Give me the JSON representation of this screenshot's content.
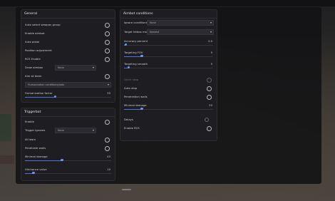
{
  "general": {
    "title": "General",
    "rows": [
      {
        "label": "Auto select weapon group",
        "type": "toggle"
      },
      {
        "label": "Enable aimbot",
        "type": "toggle"
      },
      {
        "label": "Auto pistol",
        "type": "toggle"
      },
      {
        "label": "Position adjustment",
        "type": "toggle"
      },
      {
        "label": "RCS Enable",
        "type": "toggle"
      },
      {
        "label": "Draw aimbox",
        "type": "select",
        "value": "None"
      },
      {
        "label": "Aim at team",
        "type": "toggle"
      },
      {
        "label": "Humanization conditions/slots",
        "type": "wideselect"
      },
      {
        "label": "Humanization factor",
        "type": "slider",
        "value": "35",
        "fraction": 0.35
      }
    ]
  },
  "triggerbot": {
    "title": "Triggerbot",
    "rows": [
      {
        "label": "Enable",
        "type": "toggle"
      },
      {
        "label": "Trigger Ignores",
        "type": "select",
        "value": "None"
      },
      {
        "label": "At team",
        "type": "toggle"
      },
      {
        "label": "Penetrate walls",
        "type": "toggle"
      },
      {
        "label": "Minimal damage",
        "type": "slider",
        "value": "43",
        "fraction": 0.43
      },
      {
        "label": "Hitchance value",
        "type": "slider",
        "value": "10",
        "fraction": 0.1
      }
    ]
  },
  "aimbot_conditions": {
    "title": "Aimbot conditions",
    "rows": [
      {
        "label": "Ignore conditions",
        "type": "select",
        "value": "None"
      },
      {
        "label": "Target hitbox mode",
        "type": "select",
        "value": "Nearest"
      },
      {
        "label": "Accuracy percent",
        "type": "slider",
        "value": "2.0",
        "fraction": 0.02
      },
      {
        "label": "Targeting FOV",
        "type": "slider",
        "value": "5",
        "fraction": 0.2
      },
      {
        "label": "Targeting smooth",
        "type": "slider",
        "value": "5",
        "fraction": 0.05
      },
      {
        "label": "Quick stop",
        "type": "toggle",
        "dim": true
      },
      {
        "label": "Auto stop",
        "type": "toggle"
      },
      {
        "label": "Penetration walls",
        "type": "toggle"
      },
      {
        "label": "Minimal damage",
        "type": "slider",
        "value": "20",
        "fraction": 0.2
      },
      {
        "label": "Delays",
        "type": "toggle-ex"
      },
      {
        "label": "Enable RCS",
        "type": "toggle"
      }
    ]
  },
  "colors": {
    "accent": "#4a76d8",
    "panel": "#1e1e22",
    "overlay": "#121214"
  }
}
